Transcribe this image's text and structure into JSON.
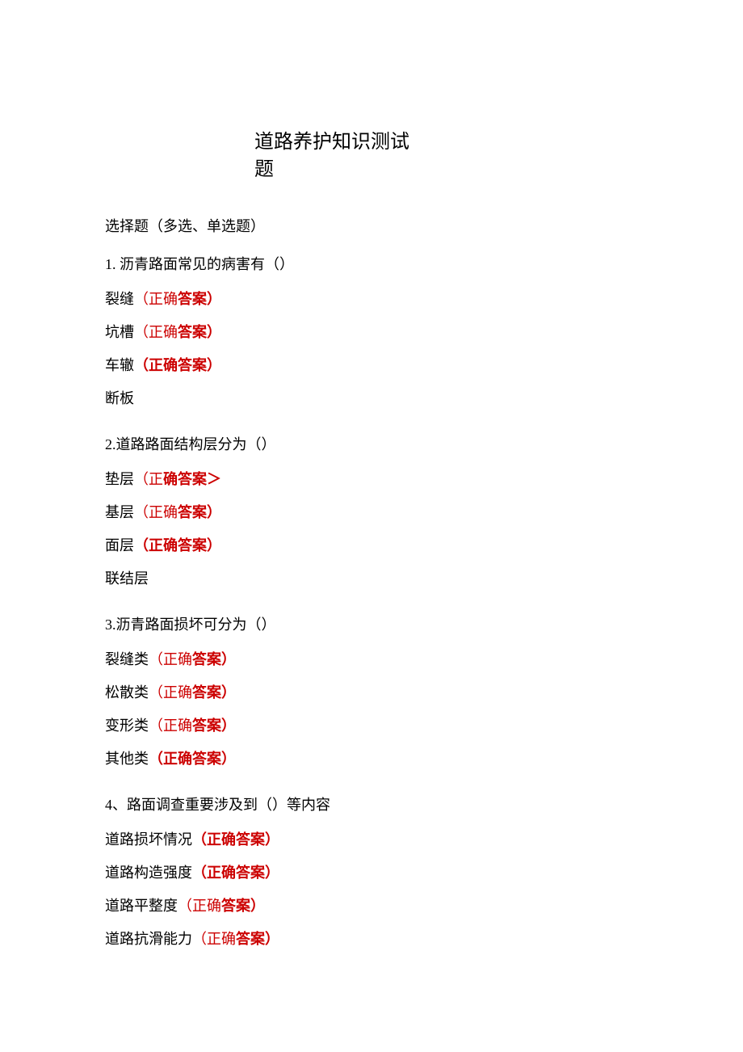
{
  "title": {
    "line1": "道路养护知识测试",
    "line2": "题"
  },
  "sectionHeading": "选择题（多选、单选题）",
  "q1": {
    "text": "1. 沥青路面常见的病害有（）",
    "a1": {
      "label": "裂缝",
      "p1": "（正确",
      "p2": "答案）"
    },
    "a2": {
      "label": "坑槽",
      "p1": "（正确",
      "p2": "答案）"
    },
    "a3": {
      "label": "车辙",
      "p1": "（正确答案）"
    },
    "a4": {
      "label": "断板"
    }
  },
  "q2": {
    "text": "2.道路路面结构层分为（）",
    "a1": {
      "label": "垫层",
      "p1": "（正",
      "p2": "确答案＞"
    },
    "a2": {
      "label": "基层",
      "p1": "（正确",
      "p2": "答案）"
    },
    "a3": {
      "label": "面层",
      "p1": "（正确答案）"
    },
    "a4": {
      "label": "联结层"
    }
  },
  "q3": {
    "text": "3.沥青路面损坏可分为（）",
    "a1": {
      "label": "裂缝类",
      "p1": "（正确",
      "p2": "答案）"
    },
    "a2": {
      "label": "松散类",
      "p1": "（正确",
      "p2": "答案）"
    },
    "a3": {
      "label": "变形类",
      "p1": "（正确",
      "p2": "答案）"
    },
    "a4": {
      "label": "其他类",
      "p1": "（正确答案）"
    }
  },
  "q4": {
    "text": "4、路面调查重要涉及到（）等内容",
    "a1": {
      "label": "道路损坏情况",
      "p1": "（正确答案）"
    },
    "a2": {
      "label": "道路构造强度",
      "p1": "（正确答案）"
    },
    "a3": {
      "label": "道路平整度",
      "p1": "（正确",
      "p2": "答案）"
    },
    "a4": {
      "label": "道路抗滑能力",
      "p1": "（正确",
      "p2": "答案）"
    }
  }
}
